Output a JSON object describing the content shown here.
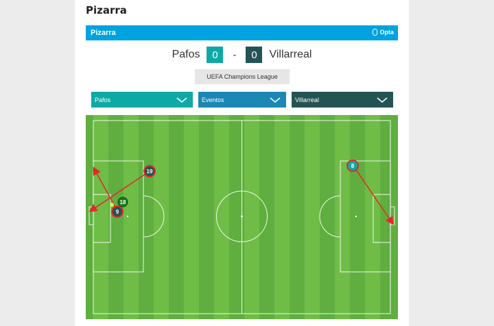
{
  "page": {
    "title": "Pizarra"
  },
  "widget": {
    "title": "Pizarra",
    "brand": "Opta"
  },
  "match": {
    "home_team": "Pafos",
    "home_score": "0",
    "separator": "-",
    "away_score": "0",
    "away_team": "Villarreal",
    "competition": "UEFA Champions League"
  },
  "filters": {
    "home_select": "Pafos",
    "events_select": "Eventos",
    "away_select": "Villarreal"
  },
  "colors": {
    "accent": "#00a3e0",
    "home": "#0fa9a5",
    "events": "#1a87b5",
    "away": "#235453",
    "arrow": "#e8252a",
    "pitch_dark": "#5fae3f",
    "pitch_light": "#6fbd46"
  },
  "players": {
    "p19": "19",
    "p18": "18",
    "p9": "9",
    "p8": "8"
  },
  "icons": {
    "brand_logo": "opta-icon",
    "dropdown": "chevron-down-icon"
  }
}
